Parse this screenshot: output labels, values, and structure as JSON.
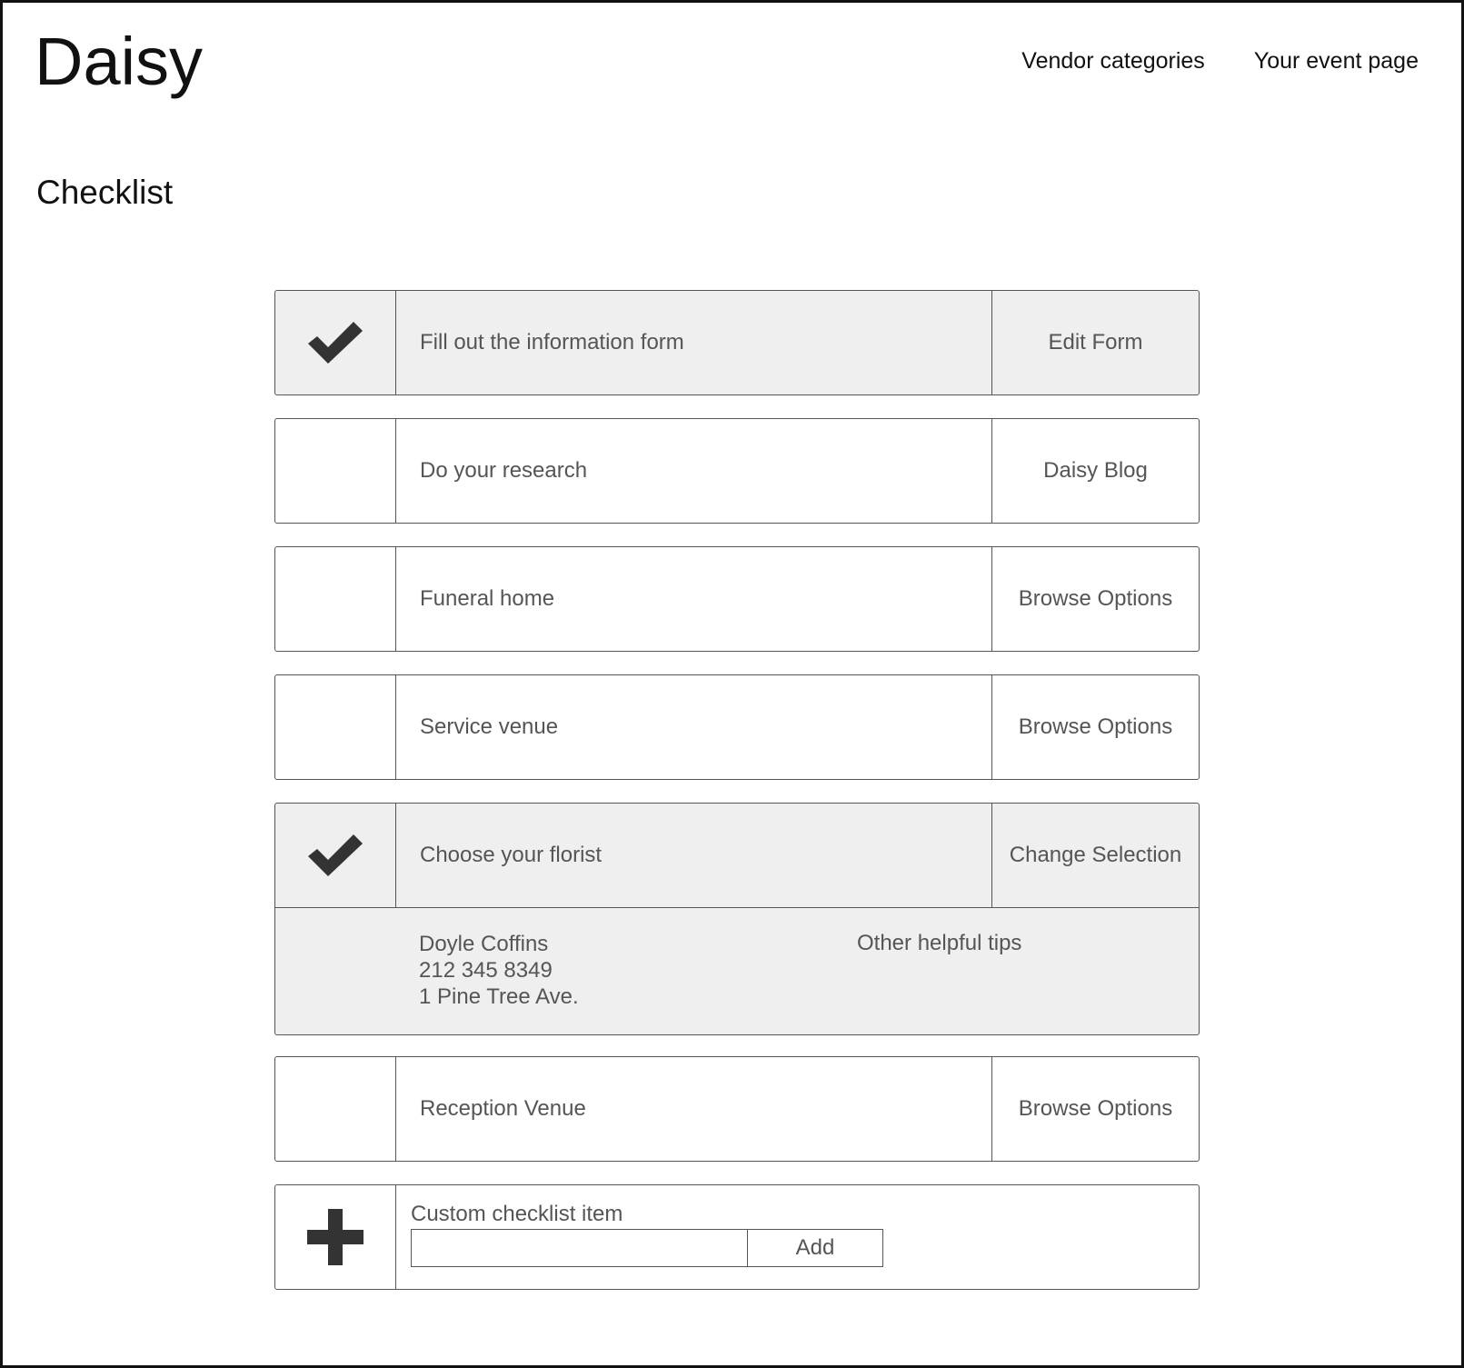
{
  "header": {
    "logo": "Daisy",
    "nav": [
      {
        "label": "Vendor categories"
      },
      {
        "label": "Your event page"
      }
    ]
  },
  "page": {
    "title": "Checklist"
  },
  "checklist": {
    "items": [
      {
        "label": "Fill out the information form",
        "action": "Edit Form",
        "checked": true
      },
      {
        "label": "Do your research",
        "action": "Daisy Blog",
        "checked": false
      },
      {
        "label": "Funeral home",
        "action": "Browse Options",
        "checked": false
      },
      {
        "label": "Service venue",
        "action": "Browse Options",
        "checked": false
      },
      {
        "label": "Choose your florist",
        "action": "Change Selection",
        "checked": true
      },
      {
        "label": "Reception Venue",
        "action": "Browse Options",
        "checked": false
      }
    ],
    "florist_details": {
      "name": "Doyle Coffins",
      "phone": "212 345 8349",
      "address": "1 Pine Tree Ave.",
      "tips_link": "Other helpful tips"
    },
    "custom": {
      "label": "Custom checklist item",
      "input_value": "",
      "add_label": "Add",
      "icon": "plus-icon"
    },
    "icons": {
      "checked": "checkmark-icon"
    },
    "colors": {
      "done_background": "#efefef",
      "text": "#555555",
      "border": "#555555"
    }
  }
}
